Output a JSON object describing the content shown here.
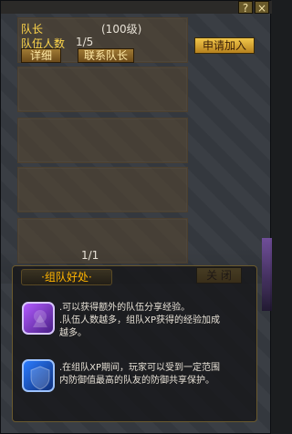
{
  "window": {
    "help_glyph": "?",
    "close_glyph": "×"
  },
  "team": {
    "leader_label": "队长",
    "leader_level": "(100级)",
    "members_label": "队伍人数",
    "members_value": "1/5",
    "details_button": "详细",
    "contact_button": "联系队长"
  },
  "actions": {
    "apply_join": "申请加入",
    "close": "关 闭"
  },
  "pagination": {
    "value": "1/1"
  },
  "benefits": {
    "title": "·组队好处·",
    "items": [
      {
        "icon": "exp-bonus-icon",
        "text": ".可以获得额外的队伍分享经验。\n.队伍人数越多，组队XP获得的经验加成越多。"
      },
      {
        "icon": "shield-icon",
        "text": ".在组队XP期间，玩家可以受到一定范围内防御值最高的队友的防御共享保护。"
      }
    ]
  },
  "colors": {
    "accent_gold": "#ffd64a",
    "title_orange": "#ffb400"
  }
}
